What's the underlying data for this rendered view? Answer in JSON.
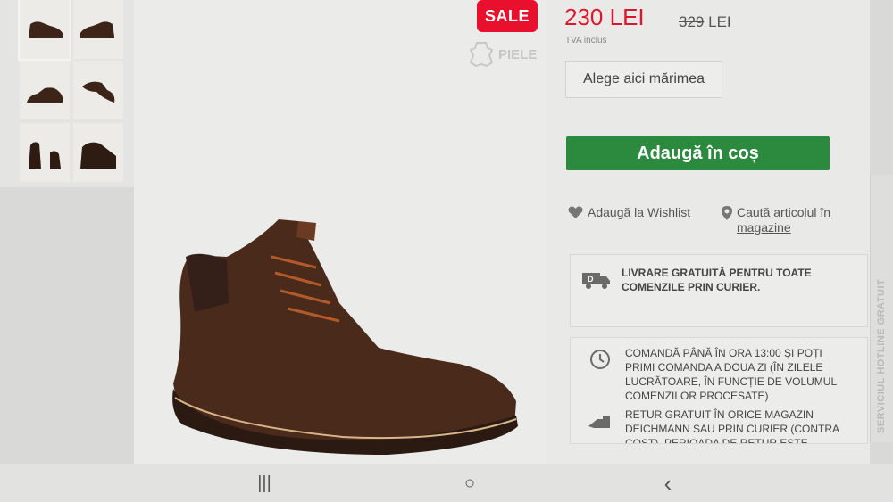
{
  "badge": {
    "sale": "SALE"
  },
  "material": {
    "label": "PIELE",
    "icon": "leather-icon"
  },
  "price": {
    "current": "230 LEI",
    "old_value": "329",
    "old_currency": "LEI",
    "vat_note": "TVA inclus"
  },
  "size_button": {
    "label": "Alege aici mărimea"
  },
  "cart_button": {
    "label": "Adaugă în coș"
  },
  "wishlist": {
    "label": "Adaugă la Wishlist",
    "icon": "heart-icon"
  },
  "find_store": {
    "label": "Caută articolul în magazine",
    "icon": "location-pin-icon"
  },
  "shipping": {
    "free_delivery": "LIVRARE GRATUITĂ PENTRU TOATE COMENZILE PRIN CURIER.",
    "order_time": "COMANDĂ PÂNĂ ÎN ORA 13:00 ȘI POȚI PRIMI COMANDA A DOUA ZI (ÎN ZILELE LUCRĂTOARE, ÎN FUNCȚIE DE VOLUMUL COMENZILOR PROCESATE)",
    "returns": "RETUR GRATUIT ÎN ORICE MAGAZIN DEICHMANN SAU PRIN CURIER (CONTRA COST). PERIOADA DE RETUR ESTE"
  },
  "side_tab": {
    "label": "SERVICIUL HOTLINE GRATUIT"
  },
  "navbar": {
    "recents": "|||",
    "home": "○",
    "back": "‹"
  },
  "colors": {
    "sale_red": "#e8102c",
    "cart_green": "#2b8a3e",
    "price_red": "#e0162d"
  }
}
